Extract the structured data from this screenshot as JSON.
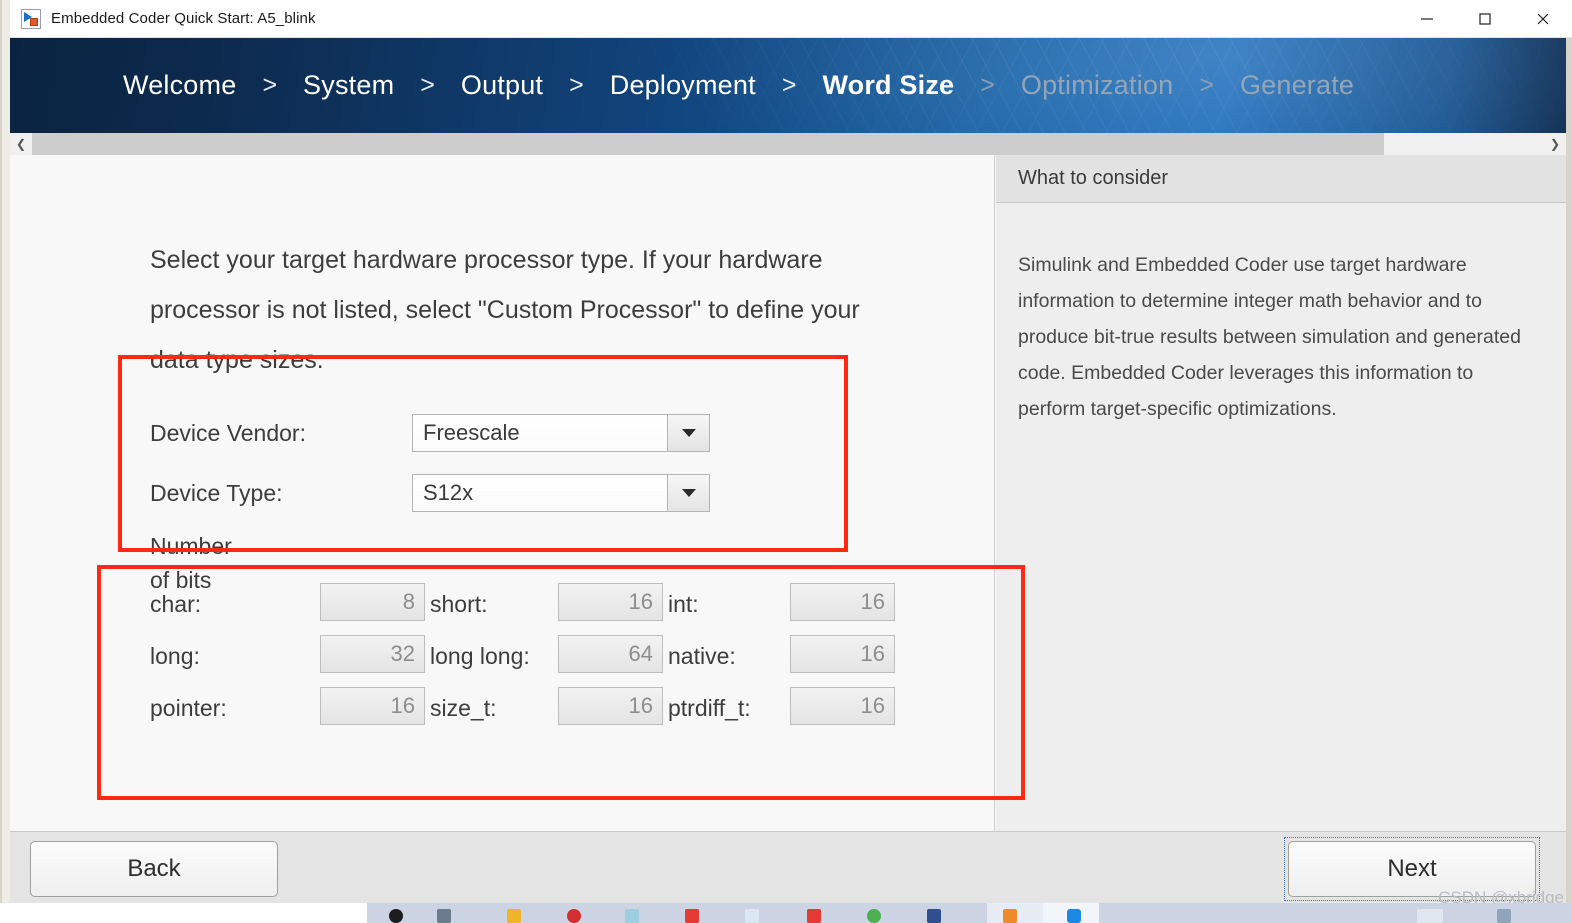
{
  "window": {
    "title": "Embedded Coder Quick Start: A5_blink",
    "icon": "simulink-icon",
    "controls": {
      "minimize": "minimize-icon",
      "maximize": "maximize-icon",
      "close": "close-icon"
    }
  },
  "breadcrumbs": {
    "separator": ">",
    "steps": [
      {
        "label": "Welcome",
        "state": "done"
      },
      {
        "label": "System",
        "state": "done"
      },
      {
        "label": "Output",
        "state": "done"
      },
      {
        "label": "Deployment",
        "state": "done"
      },
      {
        "label": "Word Size",
        "state": "current"
      },
      {
        "label": "Optimization",
        "state": "future"
      },
      {
        "label": "Generate",
        "state": "future"
      }
    ]
  },
  "scrollbar": {
    "left_arrow": "chevron-left-icon",
    "right_arrow": "chevron-right-icon"
  },
  "main": {
    "intro": "Select your target hardware processor type. If your hardware processor is not listed, select \"Custom Processor\" to define your data type sizes.",
    "fields": {
      "vendor_label": "Device Vendor:",
      "vendor_value": "Freescale",
      "type_label": "Device Type:",
      "type_value": "S12x"
    },
    "bits_heading": "Number of bits",
    "bits": [
      {
        "label": "char:",
        "value": "8"
      },
      {
        "label": "short:",
        "value": "16"
      },
      {
        "label": "int:",
        "value": "16"
      },
      {
        "label": "long:",
        "value": "32"
      },
      {
        "label": "long long:",
        "value": "64"
      },
      {
        "label": "native:",
        "value": "16"
      },
      {
        "label": "pointer:",
        "value": "16"
      },
      {
        "label": "size_t:",
        "value": "16"
      },
      {
        "label": "ptrdiff_t:",
        "value": "16"
      }
    ]
  },
  "help": {
    "header": "What to consider",
    "body": "Simulink and Embedded Coder use target hardware information to determine integer math behavior and to produce bit-true results between simulation and generated code. Embedded Coder leverages this information to perform target-specific optimizations."
  },
  "footer": {
    "back_label": "Back",
    "next_label": "Next"
  },
  "watermark": "CSDN @xbridge",
  "colors": {
    "banner_dark": "#0a2340",
    "banner_light": "#1c6dbb",
    "annotation_red": "#fc2a15",
    "help_panel_bg": "#eeeeee",
    "future_step": "#95a5b8"
  }
}
